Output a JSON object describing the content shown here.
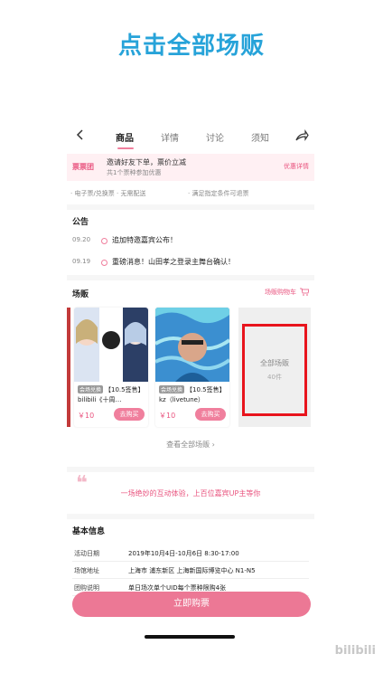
{
  "headline": "点击全部场贩",
  "nav": {
    "tabs": [
      {
        "label": "商品"
      },
      {
        "label": "详情"
      },
      {
        "label": "讨论"
      },
      {
        "label": "须知"
      }
    ],
    "back_icon": "chevron-left-icon",
    "share_icon": "share-icon"
  },
  "promo": {
    "logo": "票票团",
    "title": "邀请好友下单，票价立减",
    "subtitle": "共1个票种参加优惠",
    "link": "优惠详情"
  },
  "features": [
    "· 电子票/兑换票 · 无需配送",
    "· 满足指定条件可退票"
  ],
  "notice": {
    "title": "公告",
    "items": [
      {
        "date": "09.20",
        "text": "追加特邀嘉宾公布！"
      },
      {
        "date": "09.19",
        "text": "重磅消息！山田孝之登录主舞台确认！"
      }
    ]
  },
  "shop": {
    "title": "场贩",
    "cart_link": "场贩购物车",
    "products": [
      {
        "badge": "会场兑换",
        "name": "【10.5签售】bilibili《十周…",
        "price": "￥10",
        "buy": "去购买"
      },
      {
        "badge": "会场兑换",
        "name": "【10.5签售】kz（livetune）",
        "price": "￥10",
        "buy": "去购买"
      }
    ],
    "all_label": "全部场贩",
    "all_count": "40件",
    "view_all": "查看全部场贩 ›"
  },
  "quote": {
    "mark": "❝",
    "text": "一场绝妙的互动体验，上百位嘉宾UP主等你"
  },
  "info": {
    "title": "基本信息",
    "rows": [
      {
        "key": "活动日期",
        "value": "2019年10月4日-10月6日 8:30-17:00"
      },
      {
        "key": "场馆地址",
        "value": "上海市 浦东新区 上海新国际博览中心 N1-N5"
      },
      {
        "key": "团购说明",
        "value": "单日场次单个UID每个票种限购4张"
      }
    ]
  },
  "buy_button": "立即购票",
  "watermark": "bilibili",
  "colors": {
    "accent": "#f07f9d",
    "headline": "#27a3d9",
    "highlight": "#e8141d"
  }
}
